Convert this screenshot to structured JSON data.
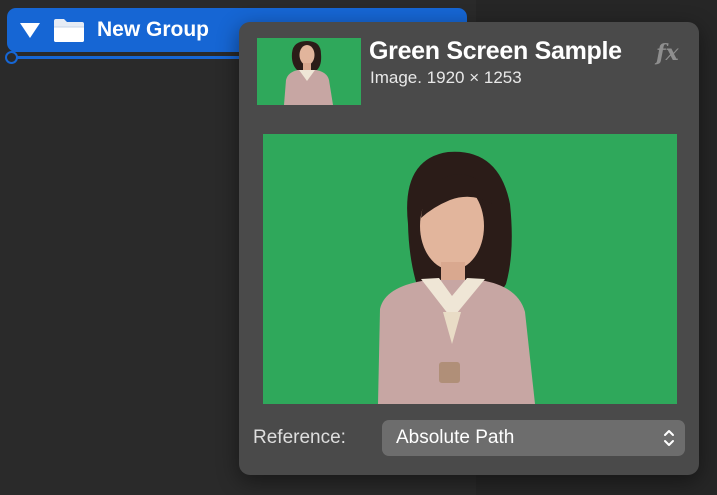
{
  "group": {
    "title": "New Group",
    "expander_icon": "disclosure-triangle-icon",
    "folder_icon": "folder-icon"
  },
  "popover": {
    "title": "Green Screen Sample",
    "subtitle": "Image. 1920 × 1253",
    "fx_label": "fx",
    "reference_label": "Reference:",
    "reference_value": "Absolute Path",
    "reference_icon": "select-stepper-icon"
  },
  "colors": {
    "background": "#2a2a2a",
    "selection": "#1666d4",
    "popover": "#4a4a4a",
    "select": "#6d6d6d",
    "green_screen": "#2fa85b"
  }
}
